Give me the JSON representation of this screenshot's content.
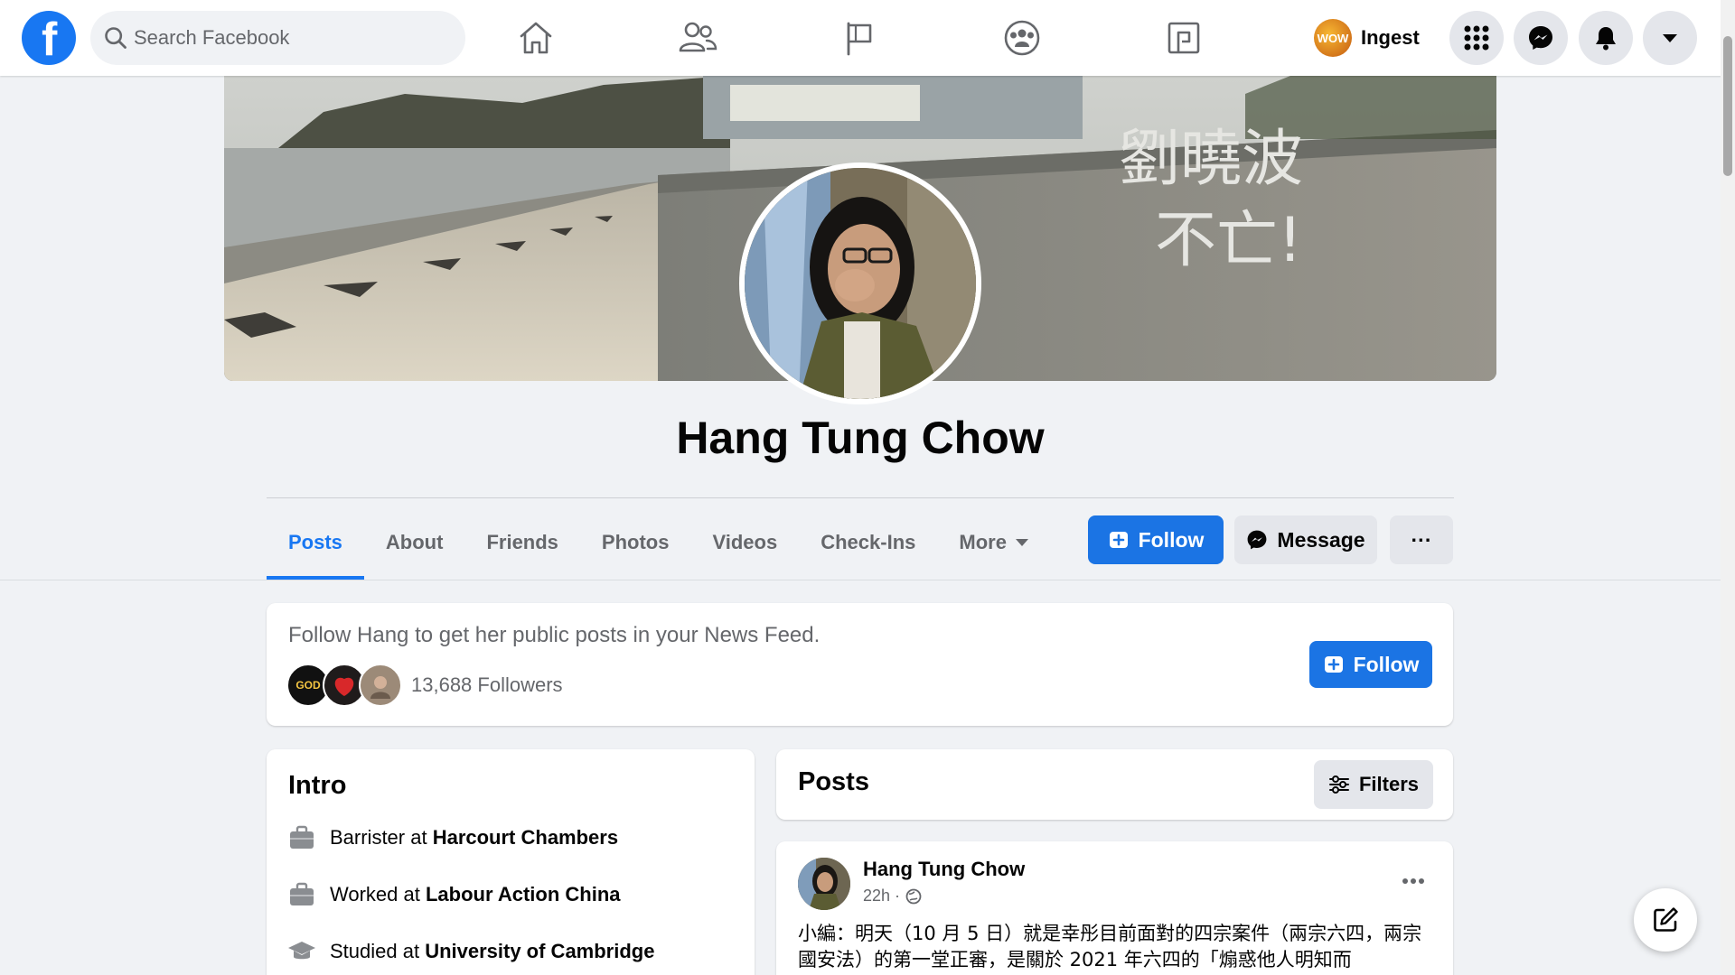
{
  "search": {
    "placeholder": "Search Facebook"
  },
  "user": {
    "name": "Ingest",
    "avatar_text": "WOW"
  },
  "profile": {
    "name": "Hang Tung Chow"
  },
  "cover": {
    "graffiti_line1": "劉曉波",
    "graffiti_line2": "不亡!"
  },
  "tabs": [
    {
      "label": "Posts"
    },
    {
      "label": "About"
    },
    {
      "label": "Friends"
    },
    {
      "label": "Photos"
    },
    {
      "label": "Videos"
    },
    {
      "label": "Check-Ins"
    },
    {
      "label": "More"
    }
  ],
  "actions": {
    "follow_label": "Follow",
    "message_label": "Message",
    "more_label": "···"
  },
  "follow_card": {
    "text": "Follow Hang to get her public posts in your News Feed.",
    "followers": "13,688 Followers",
    "follow_label": "Follow",
    "avatar1_text": "GOD"
  },
  "intro": {
    "title": "Intro",
    "items": [
      {
        "prefix": "Barrister at ",
        "bold": "Harcourt Chambers"
      },
      {
        "prefix": "Worked at ",
        "bold": "Labour Action China"
      },
      {
        "prefix": "Studied at ",
        "bold": "University of Cambridge"
      }
    ]
  },
  "posts_header": {
    "title": "Posts",
    "filters_label": "Filters"
  },
  "post": {
    "author": "Hang Tung Chow",
    "time": "22h ·",
    "text": "小編：明天（10 月 5 日）就是幸彤目前面對的四宗案件（兩宗六四，兩宗國安法）的第一堂正審，是關於 2021 年六四的「煽惑他人明知而"
  },
  "colors": {
    "brand": "#1877f2",
    "button": "#1b74e4",
    "background": "#f0f2f5"
  }
}
